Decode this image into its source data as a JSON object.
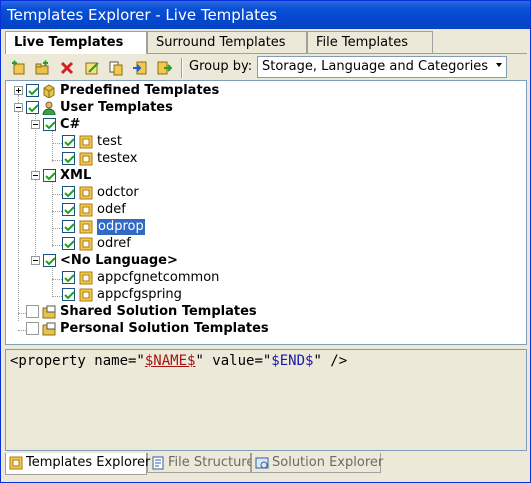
{
  "window": {
    "title": "Templates Explorer - Live Templates"
  },
  "tabs": [
    {
      "label": "Live Templates"
    },
    {
      "label": "Surround Templates"
    },
    {
      "label": "File Templates"
    }
  ],
  "toolbar": {
    "icons": [
      "new-template-icon",
      "new-folder-icon",
      "delete-icon",
      "edit-icon",
      "copy-icon",
      "import-icon",
      "export-icon"
    ],
    "group_by_label": "Group by:",
    "group_by_value": "Storage, Language and Categories"
  },
  "tree": {
    "predefined": "Predefined Templates",
    "user": "User Templates",
    "csharp": "C#",
    "test": "test",
    "testex": "testex",
    "xml": "XML",
    "odctor": "odctor",
    "odef": "odef",
    "odprop": "odprop",
    "odref": "odref",
    "nolang": "<No Language>",
    "appcfgnetcommon": "appcfgnetcommon",
    "appcfgspring": "appcfgspring",
    "shared": "Shared Solution Templates",
    "personal": "Personal Solution Templates"
  },
  "preview": {
    "p1": "<property name=\"",
    "v1": "$NAME$",
    "p2": "\" value=\"",
    "v2": "$END$",
    "p3": "\" />"
  },
  "bottom_tabs": [
    {
      "label": "Templates Explorer"
    },
    {
      "label": "File Structure"
    },
    {
      "label": "Solution Explorer"
    }
  ],
  "colors": {
    "titlebar": "#0a52d6",
    "selection": "#316ac5",
    "check": "#21a121"
  }
}
